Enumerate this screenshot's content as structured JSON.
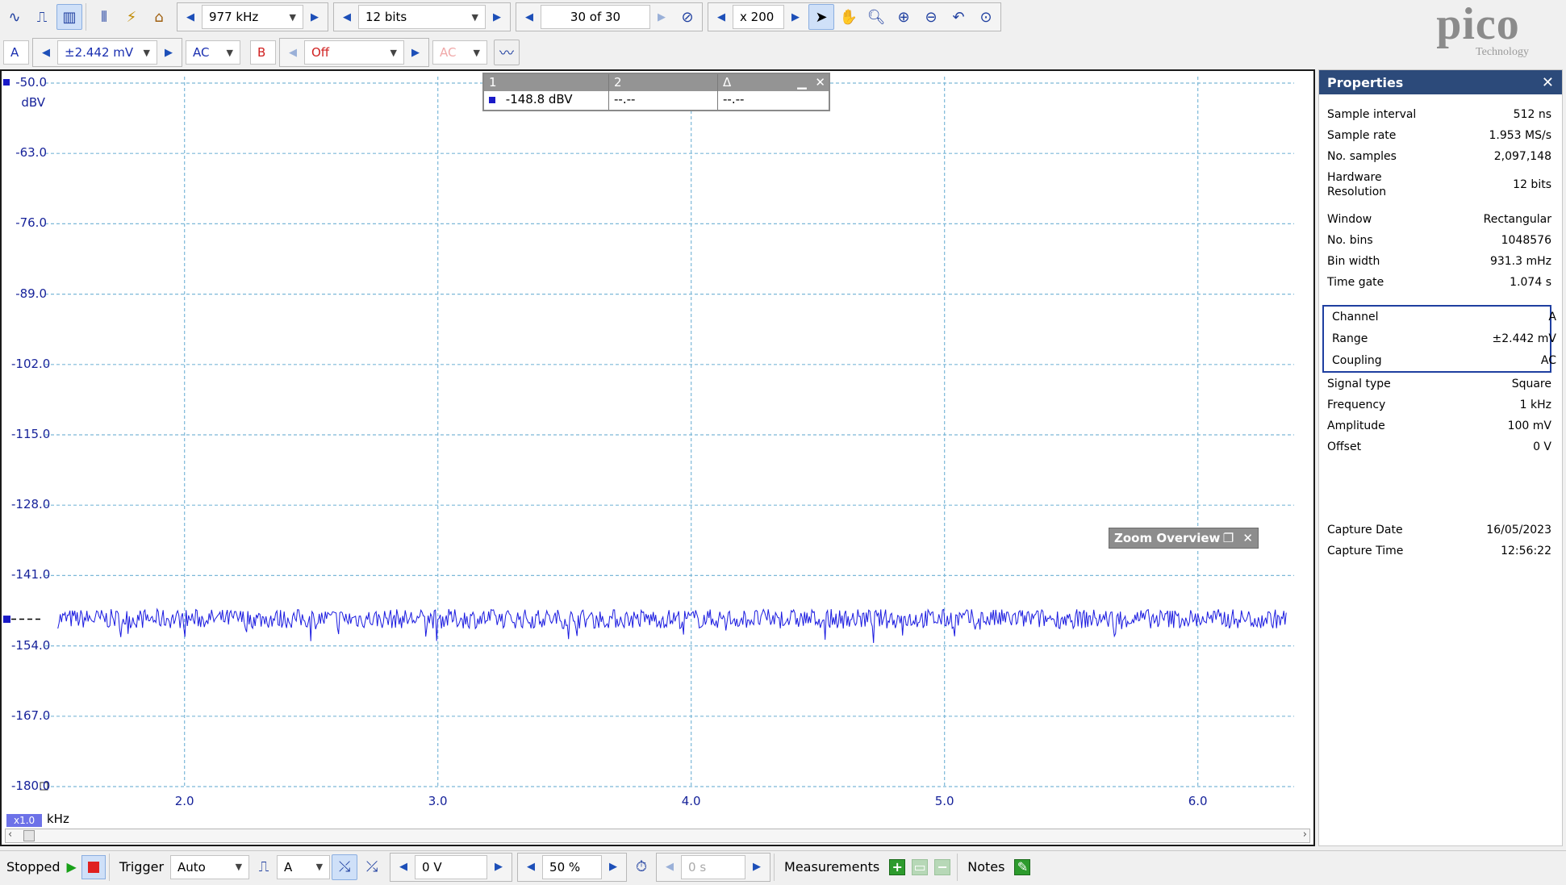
{
  "toolbar1": {
    "frequency_value": "977 kHz",
    "resolution_value": "12 bits",
    "buffer_value": "30 of 30",
    "zoom_value": "x 200"
  },
  "toolbar2": {
    "channel_a_label": "A",
    "channel_a_range": "±2.442 mV",
    "channel_a_coupling": "AC",
    "channel_b_label": "B",
    "channel_b_range": "Off",
    "channel_b_coupling": "AC"
  },
  "logo": {
    "word": "pico",
    "sub": "Technology"
  },
  "plot": {
    "y_unit": "dBV",
    "x_unit": "kHz",
    "x_multiplier": "x1.0",
    "y_ticks": [
      "-50.0",
      "-63.0",
      "-76.0",
      "-89.0",
      "-102.0",
      "-115.0",
      "-128.0",
      "-141.0",
      "-154.0",
      "-167.0",
      "-180.0"
    ],
    "x_ticks": [
      "2.0",
      "3.0",
      "4.0",
      "5.0",
      "6.0"
    ],
    "trace_color": "#1a1ae0",
    "grid_color": "#7cb8d8"
  },
  "chart_data": {
    "type": "line",
    "title": "",
    "xlabel": "kHz",
    "ylabel": "dBV",
    "xlim": [
      1.45,
      6.38
    ],
    "ylim": [
      -180.0,
      -50.0
    ],
    "grid": true,
    "series": [
      {
        "name": "A",
        "x": [
          1.5,
          2.0,
          2.5,
          3.0,
          3.5,
          4.0,
          4.5,
          5.0,
          5.5,
          6.0,
          6.35
        ],
        "y": [
          -149,
          -149,
          -149,
          -149,
          -149,
          -149,
          -149,
          -149,
          -149,
          -149,
          -149
        ]
      }
    ]
  },
  "ruler": {
    "headers": [
      "1",
      "2",
      "Δ"
    ],
    "values": [
      "-148.8 dBV",
      "--.--",
      "--.--"
    ]
  },
  "zoom_overview": {
    "title": "Zoom Overview"
  },
  "properties": {
    "title": "Properties",
    "rows": [
      {
        "label": "Sample interval",
        "value": "512 ns"
      },
      {
        "label": "Sample rate",
        "value": "1.953 MS/s"
      },
      {
        "label": "No. samples",
        "value": "2,097,148"
      },
      {
        "label": "Hardware",
        "label2": "Resolution",
        "value": "12 bits"
      },
      {
        "label": "Window",
        "value": "Rectangular"
      },
      {
        "label": "No. bins",
        "value": "1048576"
      },
      {
        "label": "Bin width",
        "value": "931.3 mHz"
      },
      {
        "label": "Time gate",
        "value": "1.074 s"
      }
    ],
    "channel_rows": [
      {
        "label": "Channel",
        "value": "A"
      },
      {
        "label": "Range",
        "value": "±2.442 mV"
      },
      {
        "label": "Coupling",
        "value": "AC"
      }
    ],
    "signal_rows": [
      {
        "label": "Signal type",
        "value": "Square"
      },
      {
        "label": "Frequency",
        "value": "1 kHz"
      },
      {
        "label": "Amplitude",
        "value": "100 mV"
      },
      {
        "label": "Offset",
        "value": "0 V"
      }
    ],
    "capture_rows": [
      {
        "label": "Capture Date",
        "value": "16/05/2023"
      },
      {
        "label": "Capture Time",
        "value": "12:56:22"
      }
    ]
  },
  "status": {
    "state": "Stopped",
    "trigger_label": "Trigger",
    "trigger_mode": "Auto",
    "trigger_channel": "A",
    "trigger_level": "0 V",
    "pre_trigger": "50 %",
    "delay": "0 s",
    "measurements_label": "Measurements",
    "notes_label": "Notes"
  }
}
